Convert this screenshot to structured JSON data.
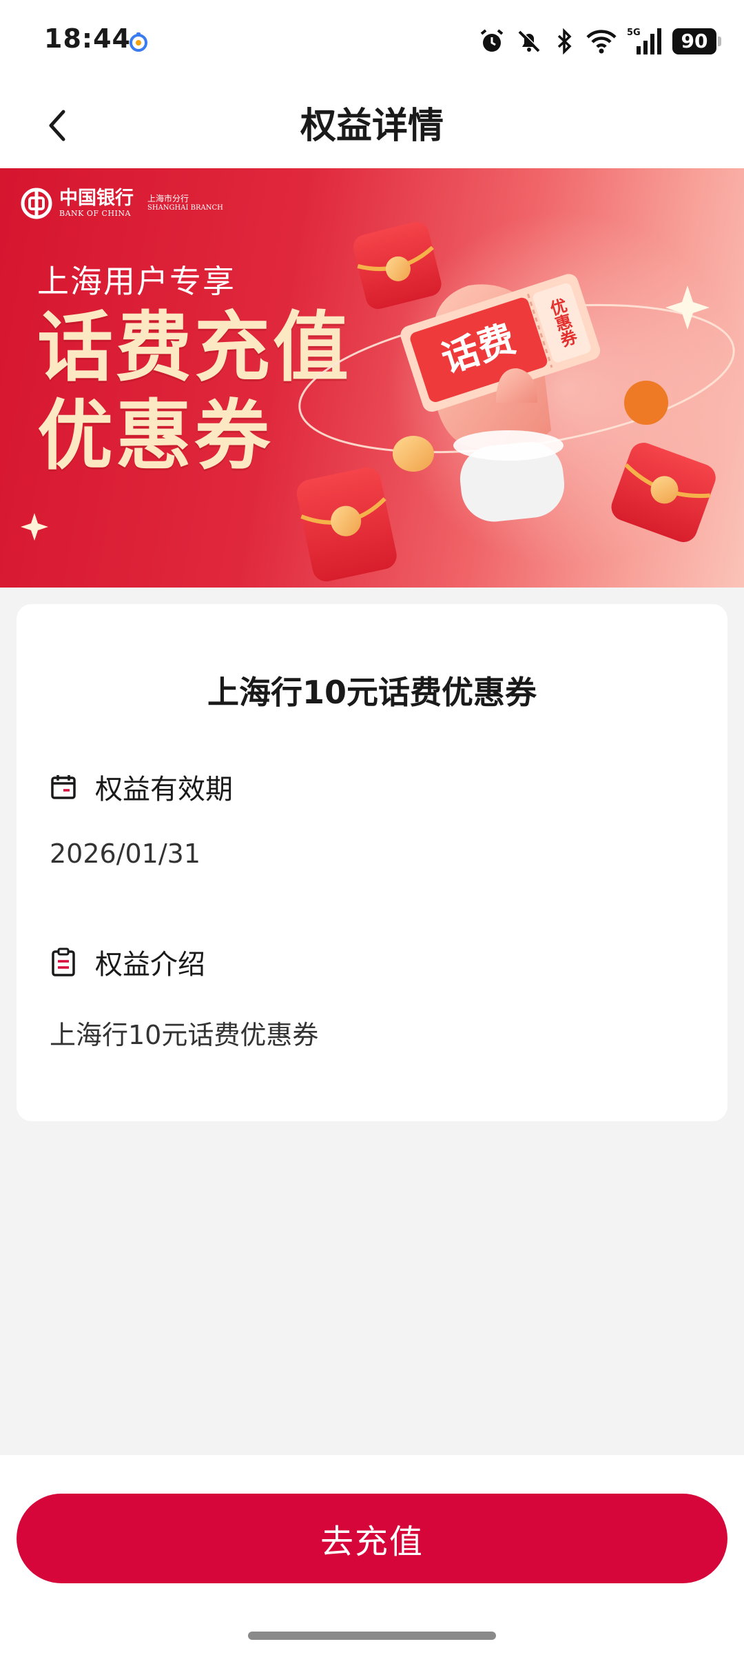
{
  "status_bar": {
    "time": "18:44",
    "network": "5G",
    "battery": "90"
  },
  "header": {
    "title": "权益详情"
  },
  "banner": {
    "bank_name": "中国银行",
    "bank_name_en": "BANK OF CHINA",
    "branch": "上海市分行",
    "branch_en": "SHANGHAI BRANCH",
    "subtitle": "上海用户专享",
    "headline_line1": "话费充值",
    "headline_line2": "优惠券",
    "ticket_main": "话费",
    "ticket_side": "优惠券"
  },
  "card": {
    "title": "上海行10元话费优惠券",
    "validity_label": "权益有效期",
    "validity_value": "2026/01/31",
    "intro_label": "权益介绍",
    "intro_value": "上海行10元话费优惠券"
  },
  "actions": {
    "recharge_label": "去充值"
  },
  "colors": {
    "primary_red": "#d7063a",
    "banner_red": "#d6152f",
    "headline_gold": "#fde8c4",
    "page_bg": "#f3f3f3"
  },
  "icons": {
    "back": "chevron-left-icon",
    "validity": "calendar-icon",
    "intro": "clipboard-icon"
  }
}
